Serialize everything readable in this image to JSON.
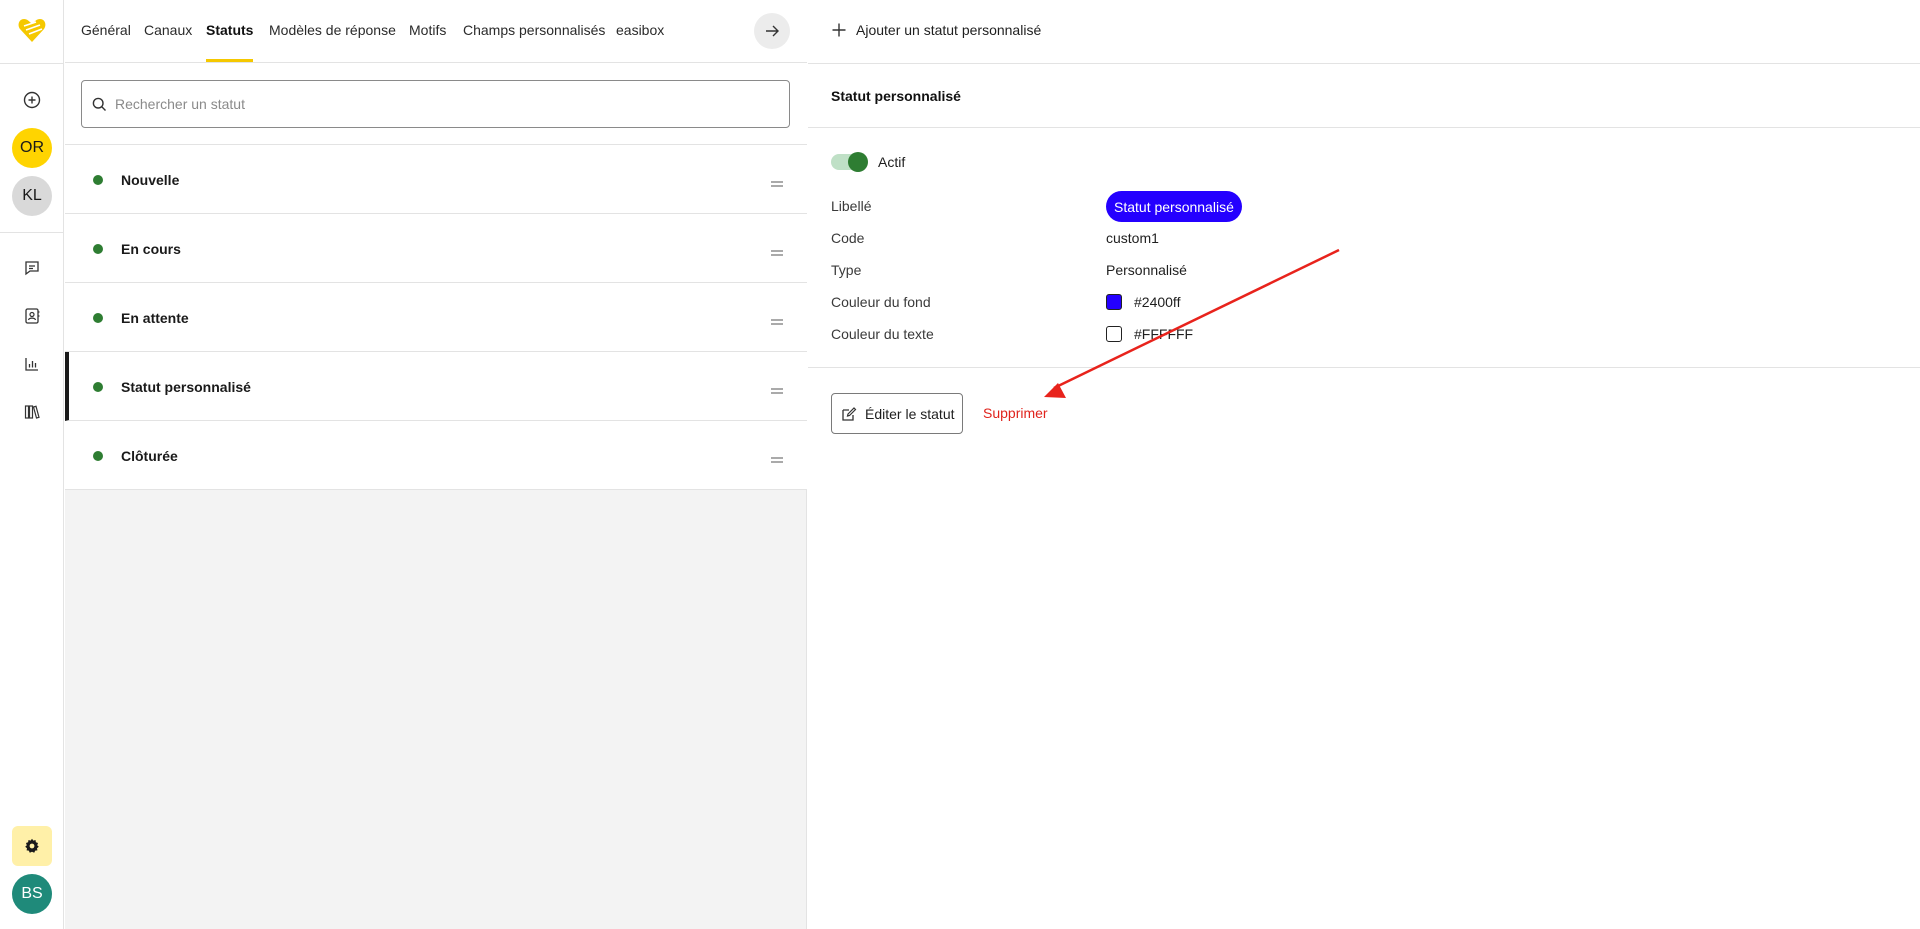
{
  "nav_rail": {
    "logo_icon": "heart-logo-icon",
    "add_icon": "plus-circle-icon",
    "avatars": [
      {
        "initials": "OR",
        "bg": "#ffd400",
        "color": "#1a1a1a"
      },
      {
        "initials": "KL",
        "bg": "#d9d9d9",
        "color": "#1a1a1a"
      }
    ],
    "nav_icons": [
      "chat-icon",
      "contacts-icon",
      "chart-icon",
      "library-icon"
    ],
    "settings_icon": "gear-icon",
    "user_avatar": {
      "initials": "BS",
      "bg": "#1f8a7a",
      "color": "#ffffff"
    }
  },
  "tabs": [
    {
      "label": "Général"
    },
    {
      "label": "Canaux"
    },
    {
      "label": "Statuts",
      "active": true
    },
    {
      "label": "Modèles de réponse"
    },
    {
      "label": "Motifs"
    },
    {
      "label": "Champs personnalisés"
    },
    {
      "label": "easibox"
    }
  ],
  "search": {
    "placeholder": "Rechercher un statut",
    "value": ""
  },
  "statuses": [
    {
      "name": "Nouvelle",
      "dot_color": "#2e7d32"
    },
    {
      "name": "En cours",
      "dot_color": "#2e7d32"
    },
    {
      "name": "En attente",
      "dot_color": "#2e7d32"
    },
    {
      "name": "Statut personnalisé",
      "dot_color": "#2e7d32",
      "selected": true
    },
    {
      "name": "Clôturée",
      "dot_color": "#2e7d32"
    }
  ],
  "detail": {
    "add_button": "Ajouter un statut personnalisé",
    "title": "Statut personnalisé",
    "active_label": "Actif",
    "active": true,
    "fields": {
      "label_label": "Libellé",
      "label_value": "Statut personnalisé",
      "code_label": "Code",
      "code_value": "custom1",
      "type_label": "Type",
      "type_value": "Personnalisé",
      "bg_color_label": "Couleur du fond",
      "bg_color_value": "#2400ff",
      "text_color_label": "Couleur du texte",
      "text_color_value": "#FFFFFF"
    },
    "edit_button": "Éditer le statut",
    "delete_button": "Supprimer"
  },
  "colors": {
    "accent": "#f5c800",
    "status_green": "#2e7d32",
    "danger": "#e0231c",
    "annotation_arrow": "#e8231c"
  }
}
